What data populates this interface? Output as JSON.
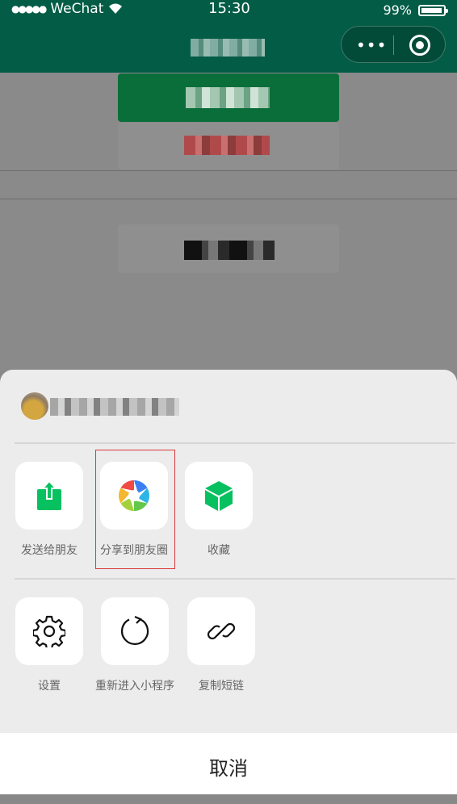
{
  "status_bar": {
    "carrier": "WeChat",
    "time": "15:30",
    "battery": "99%"
  },
  "nav": {
    "capsule_more": "•••"
  },
  "share_sheet": {
    "row1": [
      {
        "label": "发送给朋友",
        "icon": "send-to-friend-icon",
        "color": "#07c160"
      },
      {
        "label": "分享到朋友圈",
        "icon": "moments-icon",
        "color": "#multicolor"
      },
      {
        "label": "收藏",
        "icon": "favorite-icon",
        "color": "#07c160"
      }
    ],
    "row2": [
      {
        "label": "设置",
        "icon": "settings-icon"
      },
      {
        "label": "重新进入小程序",
        "icon": "reload-icon"
      },
      {
        "label": "复制短链",
        "icon": "link-icon"
      }
    ],
    "cancel": "取消"
  },
  "colors": {
    "nav_bg": "#035c46",
    "primary_green": "#07c160",
    "highlight_border": "#d9393b"
  }
}
